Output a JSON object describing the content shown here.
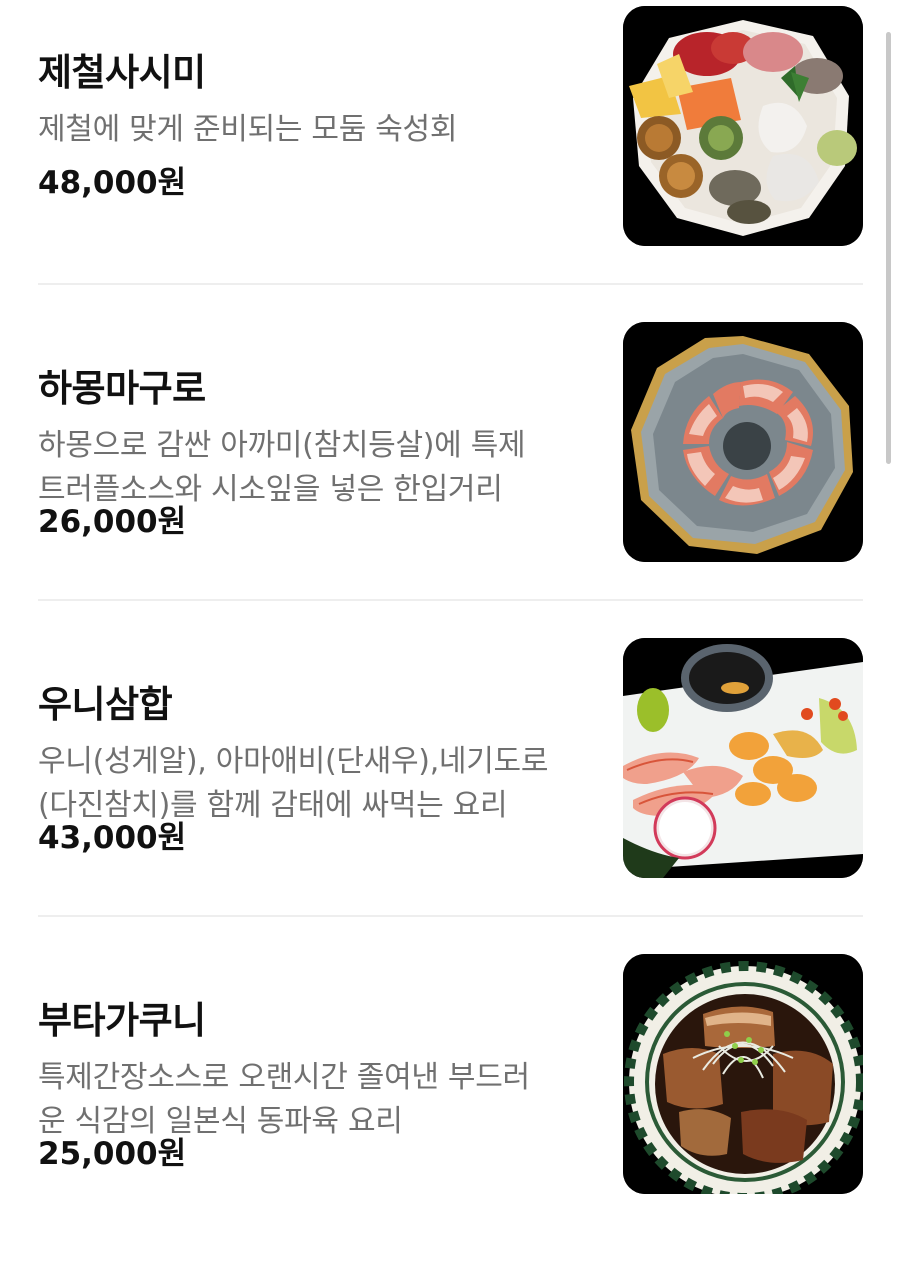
{
  "menu": {
    "items": [
      {
        "name": "제철사시미",
        "desc_lines": [
          "제철에 맞게 준비되는 모둠 숙성회"
        ],
        "price": "48,000원",
        "image": "sashimi-platter"
      },
      {
        "name": "하몽마구로",
        "desc_lines": [
          "하몽으로 감싼 아까미(참치등살)에 특제",
          "트러플소스와 시소잎을 넣은 한입거리"
        ],
        "price": "26,000원",
        "image": "jamon-tuna-ring"
      },
      {
        "name": "우니삼합",
        "desc_lines": [
          "우니(성게알), 아마애비(단새우),네기도로",
          "(다진참치)를 함께 감태에 싸먹는 요리"
        ],
        "price": "43,000원",
        "image": "uni-shrimp-plate"
      },
      {
        "name": "부타가쿠니",
        "desc_lines": [
          "특제간장소스로 오랜시간 졸여낸 부드러",
          "운 식감의 일본식 동파육 요리"
        ],
        "price": "25,000원",
        "image": "braised-pork-bowl"
      }
    ]
  },
  "colors": {
    "text_primary": "#111111",
    "text_secondary": "#707070",
    "divider": "#eeeeee",
    "image_background": "#000000",
    "scrollbar": "#c8c8c8"
  }
}
